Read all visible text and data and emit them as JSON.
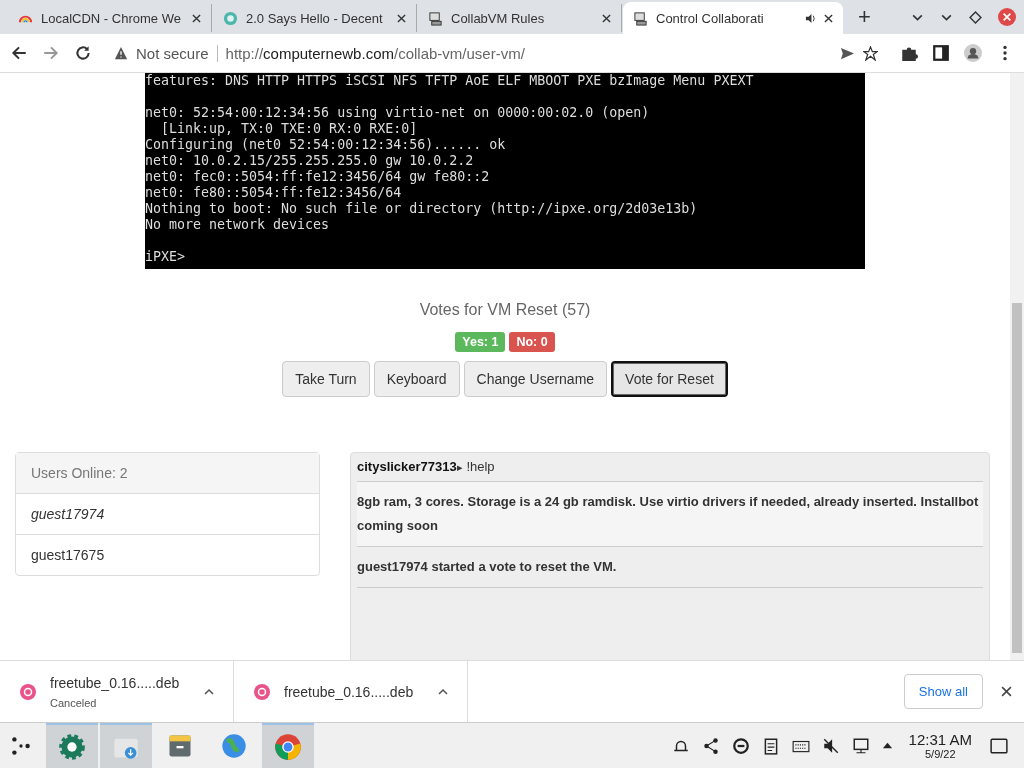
{
  "tabs": [
    {
      "title": "LocalCDN - Chrome We",
      "kind": "cdn",
      "selected": false,
      "audio": false
    },
    {
      "title": "2.0 Says Hello - Decent",
      "kind": "globe",
      "selected": false,
      "audio": false
    },
    {
      "title": "CollabVM Rules",
      "kind": "vm",
      "selected": false,
      "audio": false
    },
    {
      "title": "Control Collaborati",
      "kind": "vm",
      "selected": true,
      "audio": true
    }
  ],
  "new_tab": "+",
  "address": {
    "security": "Not secure",
    "scheme": "http://",
    "host": "computernewb.com",
    "path": "/collab-vm/user-vm/"
  },
  "terminal": {
    "blocks": [
      [
        "features: DNS HTTP HTTPS iSCSI NFS TFTP AoE ELF MBOOT PXE bzImage Menu PXEXT"
      ],
      [
        "net0: 52:54:00:12:34:56 using virtio-net on 0000:00:02.0 (open)",
        "  [Link:up, TX:0 TXE:0 RX:0 RXE:0]",
        "Configuring (net0 52:54:00:12:34:56)...... ok",
        "net0: 10.0.2.15/255.255.255.0 gw 10.0.2.2",
        "net0: fec0::5054:ff:fe12:3456/64 gw fe80::2",
        "net0: fe80::5054:ff:fe12:3456/64",
        "Nothing to boot: No such file or directory (http://ipxe.org/2d03e13b)",
        "No more network devices"
      ],
      [
        "iPXE>"
      ]
    ]
  },
  "vote": {
    "title": "Votes for VM Reset (57)",
    "yes": "Yes: 1",
    "no": "No: 0"
  },
  "buttons": [
    {
      "label": "Take Turn",
      "focused": false
    },
    {
      "label": "Keyboard",
      "focused": false
    },
    {
      "label": "Change Username",
      "focused": false
    },
    {
      "label": "Vote for Reset",
      "focused": true
    }
  ],
  "users": {
    "heading": "Users Online: 2",
    "items": [
      {
        "name": "guest17974",
        "current": true
      },
      {
        "name": "guest17675",
        "current": false
      }
    ]
  },
  "chat": [
    {
      "kind": "chat",
      "user": "cityslicker77313",
      "arrow": "▸",
      "text": "!help"
    },
    {
      "kind": "notice",
      "text": "8gb ram, 3 cores. Storage is a 24 gb ramdisk. Use virtio drivers if needed, already inserted. Installbot coming soon"
    },
    {
      "kind": "notice",
      "text": "guest17974 started a vote to reset the VM."
    }
  ],
  "downloads": [
    {
      "name": "freetube_0.16.....deb",
      "status": "Canceled"
    },
    {
      "name": "freetube_0.16.....deb"
    }
  ],
  "show_all": "Show all",
  "taskbar": {
    "apps": [
      {
        "kind": "gear",
        "selected": true
      },
      {
        "kind": "download",
        "selected": true
      },
      {
        "kind": "archive",
        "selected": false
      },
      {
        "kind": "globe",
        "selected": false
      },
      {
        "kind": "chrome",
        "selected": true
      }
    ],
    "time": "12:31 AM",
    "date": "5/9/22"
  }
}
